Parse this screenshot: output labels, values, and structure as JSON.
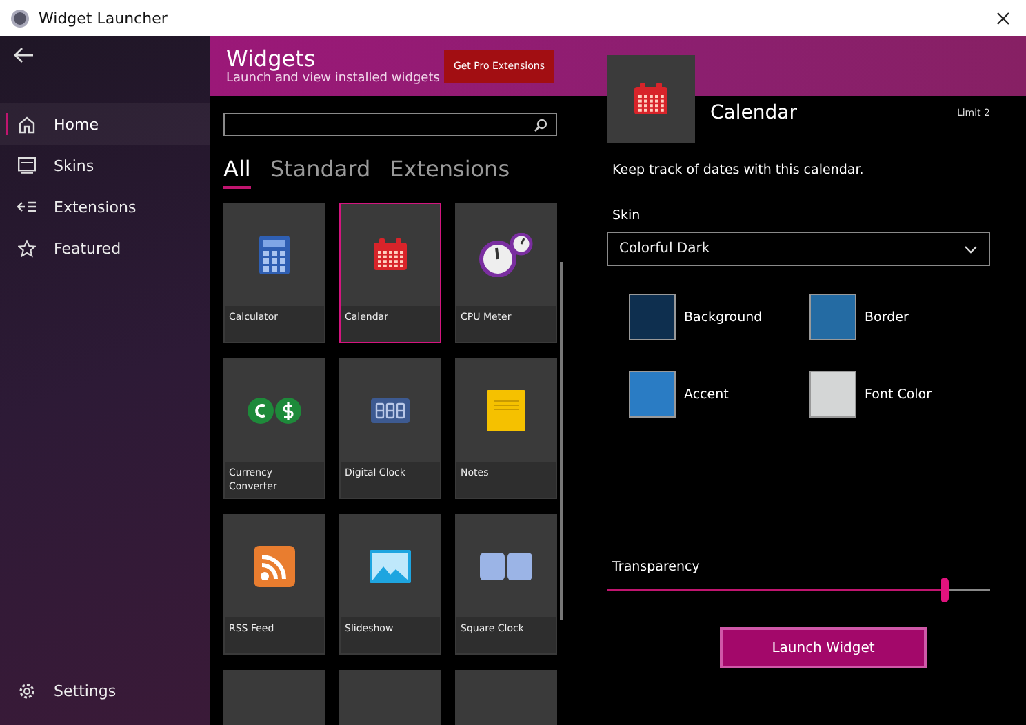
{
  "window": {
    "title": "Widget Launcher"
  },
  "sidebar": {
    "items": [
      {
        "label": "Home",
        "selected": true
      },
      {
        "label": "Skins",
        "selected": false
      },
      {
        "label": "Extensions",
        "selected": false
      },
      {
        "label": "Featured",
        "selected": false
      }
    ],
    "settings": "Settings"
  },
  "header": {
    "title": "Widgets",
    "subtitle": "Launch and view installed widgets",
    "pro_button": "Get Pro Extensions"
  },
  "tabs": [
    {
      "label": "All",
      "selected": true
    },
    {
      "label": "Standard",
      "selected": false
    },
    {
      "label": "Extensions",
      "selected": false
    }
  ],
  "widgets": [
    {
      "label": "Calculator",
      "selected": false
    },
    {
      "label": "Calendar",
      "selected": true
    },
    {
      "label": "CPU Meter",
      "selected": false
    },
    {
      "label": "Currency Converter",
      "selected": false
    },
    {
      "label": "Digital Clock",
      "selected": false
    },
    {
      "label": "Notes",
      "selected": false
    },
    {
      "label": "RSS Feed",
      "selected": false
    },
    {
      "label": "Slideshow",
      "selected": false
    },
    {
      "label": "Square Clock",
      "selected": false
    }
  ],
  "detail": {
    "name": "Calendar",
    "limit": "Limit 2",
    "description": "Keep track of dates with this calendar.",
    "skin_label": "Skin",
    "skin_value": "Colorful Dark",
    "colors": [
      {
        "label": "Background",
        "color": "#0e2f4f"
      },
      {
        "label": "Border",
        "color": "#246ba3"
      },
      {
        "label": "Accent",
        "color": "#2a7cc4"
      },
      {
        "label": "Font Color",
        "color": "#d4d6d6"
      }
    ],
    "transparency": {
      "label": "Transparency",
      "level": 0.88
    },
    "launch_button": "Launch Widget"
  }
}
